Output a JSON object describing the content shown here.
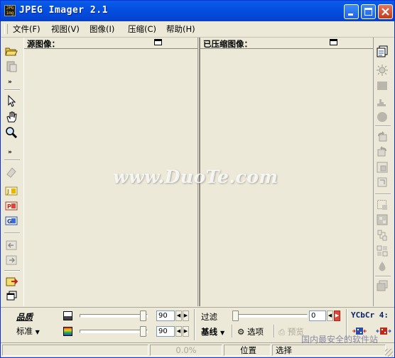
{
  "window": {
    "title": "JPEG Imager 2.1",
    "icon_label": "JPEG imager"
  },
  "menu": [
    {
      "label": "文件(F)"
    },
    {
      "label": "视图(V)"
    },
    {
      "label": "图像(I)"
    },
    {
      "label": "压缩(C)"
    },
    {
      "label": "帮助(H)"
    }
  ],
  "panels": {
    "source_title": "源图像：",
    "compressed_title": "已压缩图像："
  },
  "controls": {
    "quality_label": "品质",
    "mode_label": "标准",
    "quality_value": "90",
    "color_value": "90",
    "filter_label": "过滤",
    "filter_value": "0",
    "baseline_label": "基线",
    "options_label": "选项",
    "preview_label": "预览",
    "subsampling": "YCbCr 4:"
  },
  "status": {
    "size": "0.0%",
    "position_label": "位置",
    "selection_label": "选择"
  },
  "watermark": {
    "main": "www.DuoTe.com",
    "bottom": "国内最安全的软件站"
  },
  "colors": {
    "titlebar": "#0450e0",
    "face": "#ece9d8",
    "accent_blue": "#0a246a",
    "close_red": "#c23a1c"
  },
  "icons": {
    "left_toolbar": [
      "open-folder-icon",
      "paste-icon",
      "expand-chevron-icon",
      "pointer-icon",
      "hand-icon",
      "zoom-icon",
      "expand-chevron-icon",
      "filter-icon",
      "jpg-format-icon",
      "png-format-icon",
      "gif-format-icon",
      "arrow-left-icon",
      "arrow-right-icon",
      "export-icon",
      "windows-icon"
    ],
    "right_toolbar": [
      "copy-compressed-icon",
      "brightness-icon",
      "contrast-icon",
      "histogram-icon",
      "circle-icon",
      "rotate-left-icon",
      "rotate-right-icon",
      "resize-icon",
      "crop-icon",
      "select-icon",
      "smooth-icon",
      "sharpen-icon",
      "grid-icon",
      "drop-icon",
      "layers-icon"
    ]
  }
}
